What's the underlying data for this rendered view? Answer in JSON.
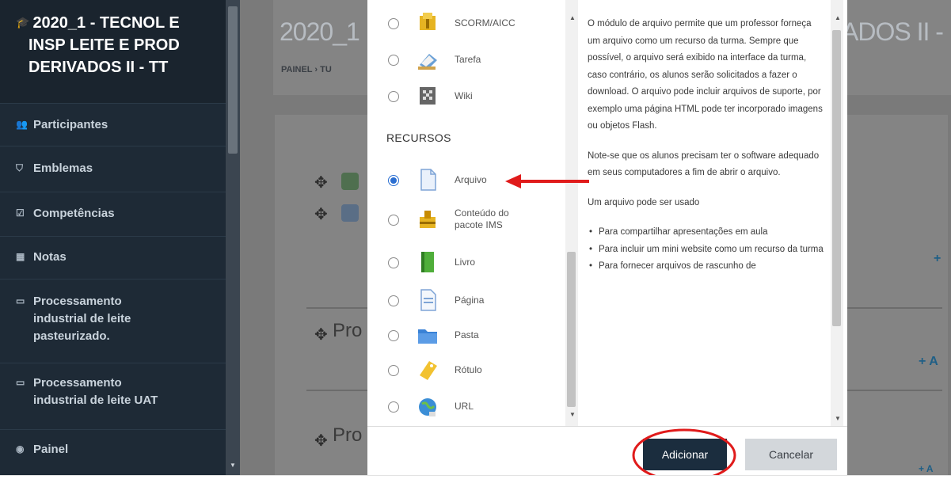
{
  "sidebar": {
    "course_lines": [
      "2020_1 - TECNOL E",
      "INSP LEITE E PROD",
      "DERIVADOS II - TT"
    ],
    "items": [
      {
        "icon": "users-icon",
        "label": "Participantes"
      },
      {
        "icon": "shield-icon",
        "label": "Emblemas"
      },
      {
        "icon": "checkbox-icon",
        "label": "Competências"
      },
      {
        "icon": "table-icon",
        "label": "Notas"
      },
      {
        "icon": "folder-icon",
        "label_lines": [
          "Processamento",
          "industrial de leite",
          "pasteurizado."
        ]
      },
      {
        "icon": "folder-icon",
        "label_lines": [
          "Processamento",
          "industrial de leite UAT"
        ]
      },
      {
        "icon": "dashboard-icon",
        "label": "Painel"
      }
    ]
  },
  "background": {
    "title_left": "2020_1",
    "title_right": "ADOS II -",
    "breadcrumb": "PAINEL  ›  TU",
    "section_1": "Pro",
    "section_2": "Pro",
    "add_link": "+ A"
  },
  "modal": {
    "activities": [
      {
        "icon": "scorm-icon",
        "label": "SCORM/AICC",
        "selected": false
      },
      {
        "icon": "assignment-icon",
        "label": "Tarefa",
        "selected": false
      },
      {
        "icon": "wiki-icon",
        "label": "Wiki",
        "selected": false
      }
    ],
    "resources_heading": "RECURSOS",
    "resources": [
      {
        "icon": "file-icon",
        "label": "Arquivo",
        "selected": true
      },
      {
        "icon": "ims-package-icon",
        "label_lines": [
          "Conteúdo do",
          "pacote IMS"
        ],
        "selected": false
      },
      {
        "icon": "book-icon",
        "label": "Livro",
        "selected": false
      },
      {
        "icon": "page-icon",
        "label": "Página",
        "selected": false
      },
      {
        "icon": "folder-icon",
        "label": "Pasta",
        "selected": false
      },
      {
        "icon": "label-icon",
        "label": "Rótulo",
        "selected": false
      },
      {
        "icon": "url-icon",
        "label": "URL",
        "selected": false
      }
    ],
    "description": {
      "p1": "O módulo de arquivo permite que um professor forneça um arquivo como um recurso da turma. Sempre que possível, o arquivo será exibido na interface da turma, caso contrário, os alunos serão solicitados a fazer o download. O arquivo pode incluir arquivos de suporte, por exemplo uma página HTML pode ter incorporado imagens ou objetos Flash.",
      "p2": "Note-se que os alunos precisam ter o software adequado em seus computadores a fim de abrir o arquivo.",
      "p3": "Um arquivo pode ser usado",
      "bullets": [
        "Para compartilhar apresentações em aula",
        "Para incluir um mini website como um recurso da turma",
        "Para fornecer arquivos de rascunho de"
      ]
    },
    "add_button": "Adicionar",
    "cancel_button": "Cancelar"
  },
  "colors": {
    "sidebar": "#1e2a36",
    "primary_button": "#1b2d3e",
    "radio_selected": "#2a6ed1",
    "annotation": "#e01b1b"
  }
}
